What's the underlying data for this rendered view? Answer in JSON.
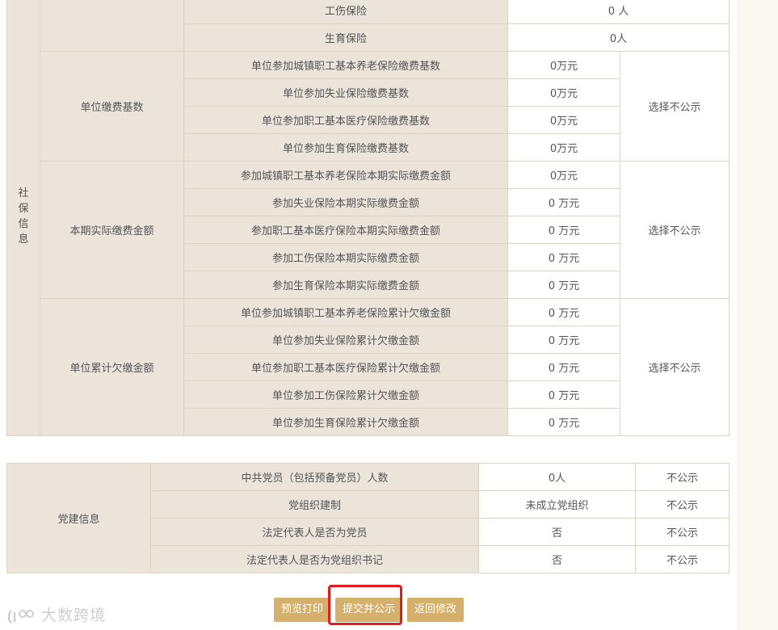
{
  "social_insurance": {
    "section_label": [
      "社",
      "保",
      "信",
      "息"
    ],
    "top_rows": [
      {
        "label": "工伤保险",
        "value": "0 人"
      },
      {
        "label": "生育保险",
        "value": "0人"
      }
    ],
    "groups": [
      {
        "title": "单位缴费基数",
        "visibility": "选择不公示",
        "rows": [
          {
            "label": "单位参加城镇职工基本养老保险缴费基数",
            "value": "0万元"
          },
          {
            "label": "单位参加失业保险缴费基数",
            "value": "0万元"
          },
          {
            "label": "单位参加职工基本医疗保险缴费基数",
            "value": "0万元"
          },
          {
            "label": "单位参加生育保险缴费基数",
            "value": "0万元"
          }
        ]
      },
      {
        "title": "本期实际缴费金额",
        "visibility": "选择不公示",
        "rows": [
          {
            "label": "参加城镇职工基本养老保险本期实际缴费金额",
            "value": "0万元"
          },
          {
            "label": "参加失业保险本期实际缴费金额",
            "value": "0 万元"
          },
          {
            "label": "参加职工基本医疗保险本期实际缴费金额",
            "value": "0 万元"
          },
          {
            "label": "参加工伤保险本期实际缴费金额",
            "value": "0 万元"
          },
          {
            "label": "参加生育保险本期实际缴费金额",
            "value": "0 万元"
          }
        ]
      },
      {
        "title": "单位累计欠缴金额",
        "visibility": "选择不公示",
        "rows": [
          {
            "label": "单位参加城镇职工基本养老保险累计欠缴金额",
            "value": "0 万元"
          },
          {
            "label": "单位参加失业保险累计欠缴金额",
            "value": "0 万元"
          },
          {
            "label": "单位参加职工基本医疗保险累计欠缴金额",
            "value": "0 万元"
          },
          {
            "label": "单位参加工伤保险累计欠缴金额",
            "value": "0 万元"
          },
          {
            "label": "单位参加生育保险累计欠缴金额",
            "value": "0 万元"
          }
        ]
      }
    ]
  },
  "party": {
    "title": "党建信息",
    "rows": [
      {
        "label": "中共党员（包括预备党员）人数",
        "value": "0人",
        "visibility": "不公示"
      },
      {
        "label": "党组织建制",
        "value": "未成立党组织",
        "visibility": "不公示"
      },
      {
        "label": "法定代表人是否为党员",
        "value": "否",
        "visibility": "不公示"
      },
      {
        "label": "法定代表人是否为党组织书记",
        "value": "否",
        "visibility": "不公示"
      }
    ]
  },
  "buttons": {
    "preview_print": "预览打印",
    "submit_publish": "提交并公示",
    "return_edit": "返回修改"
  },
  "watermark": {
    "text": "大数跨境"
  },
  "colors": {
    "label_bg": "#ebe4da",
    "border": "#dcd3c4",
    "button_bg": "#d4b06a",
    "highlight": "#e31c1c"
  }
}
